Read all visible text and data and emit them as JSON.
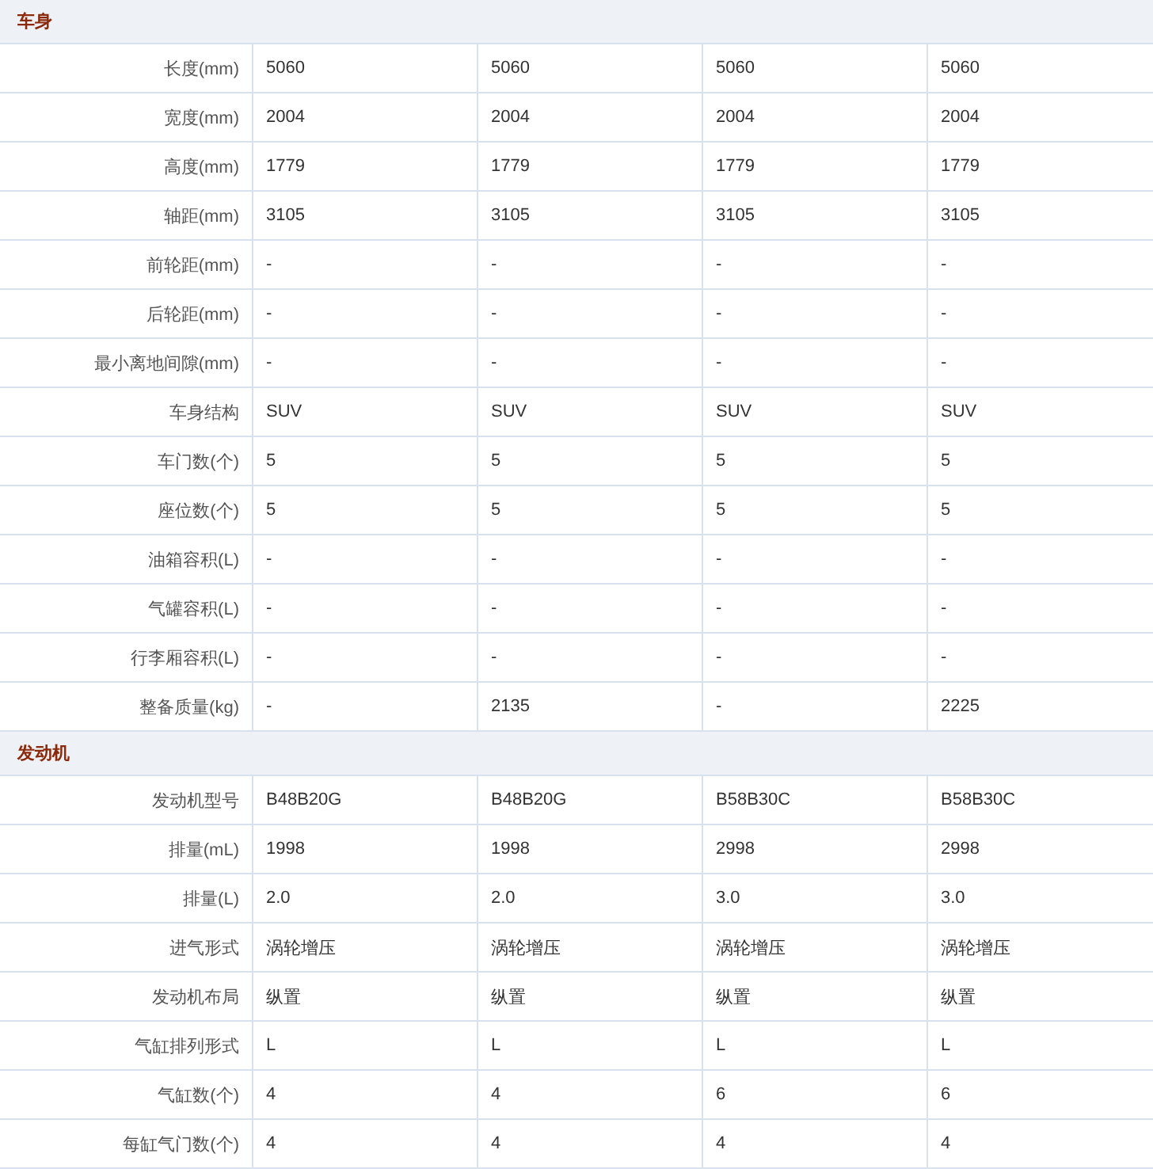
{
  "sections": [
    {
      "title": "车身",
      "rows": [
        {
          "label": "长度(mm)",
          "values": [
            "5060",
            "5060",
            "5060",
            "5060"
          ]
        },
        {
          "label": "宽度(mm)",
          "values": [
            "2004",
            "2004",
            "2004",
            "2004"
          ]
        },
        {
          "label": "高度(mm)",
          "values": [
            "1779",
            "1779",
            "1779",
            "1779"
          ]
        },
        {
          "label": "轴距(mm)",
          "values": [
            "3105",
            "3105",
            "3105",
            "3105"
          ]
        },
        {
          "label": "前轮距(mm)",
          "values": [
            "-",
            "-",
            "-",
            "-"
          ]
        },
        {
          "label": "后轮距(mm)",
          "values": [
            "-",
            "-",
            "-",
            "-"
          ]
        },
        {
          "label": "最小离地间隙(mm)",
          "values": [
            "-",
            "-",
            "-",
            "-"
          ]
        },
        {
          "label": "车身结构",
          "values": [
            "SUV",
            "SUV",
            "SUV",
            "SUV"
          ]
        },
        {
          "label": "车门数(个)",
          "values": [
            "5",
            "5",
            "5",
            "5"
          ]
        },
        {
          "label": "座位数(个)",
          "values": [
            "5",
            "5",
            "5",
            "5"
          ]
        },
        {
          "label": "油箱容积(L)",
          "values": [
            "-",
            "-",
            "-",
            "-"
          ]
        },
        {
          "label": "气罐容积(L)",
          "values": [
            "-",
            "-",
            "-",
            "-"
          ]
        },
        {
          "label": "行李厢容积(L)",
          "values": [
            "-",
            "-",
            "-",
            "-"
          ]
        },
        {
          "label": "整备质量(kg)",
          "values": [
            "-",
            "2135",
            "-",
            "2225"
          ]
        }
      ]
    },
    {
      "title": "发动机",
      "rows": [
        {
          "label": "发动机型号",
          "values": [
            "B48B20G",
            "B48B20G",
            "B58B30C",
            "B58B30C"
          ]
        },
        {
          "label": "排量(mL)",
          "values": [
            "1998",
            "1998",
            "2998",
            "2998"
          ]
        },
        {
          "label": "排量(L)",
          "values": [
            "2.0",
            "2.0",
            "3.0",
            "3.0"
          ]
        },
        {
          "label": "进气形式",
          "values": [
            "涡轮增压",
            "涡轮增压",
            "涡轮增压",
            "涡轮增压"
          ]
        },
        {
          "label": "发动机布局",
          "values": [
            "纵置",
            "纵置",
            "纵置",
            "纵置"
          ]
        },
        {
          "label": "气缸排列形式",
          "values": [
            "L",
            "L",
            "L",
            "L"
          ]
        },
        {
          "label": "气缸数(个)",
          "values": [
            "4",
            "4",
            "6",
            "6"
          ]
        },
        {
          "label": "每缸气门数(个)",
          "values": [
            "4",
            "4",
            "4",
            "4"
          ]
        }
      ]
    }
  ]
}
